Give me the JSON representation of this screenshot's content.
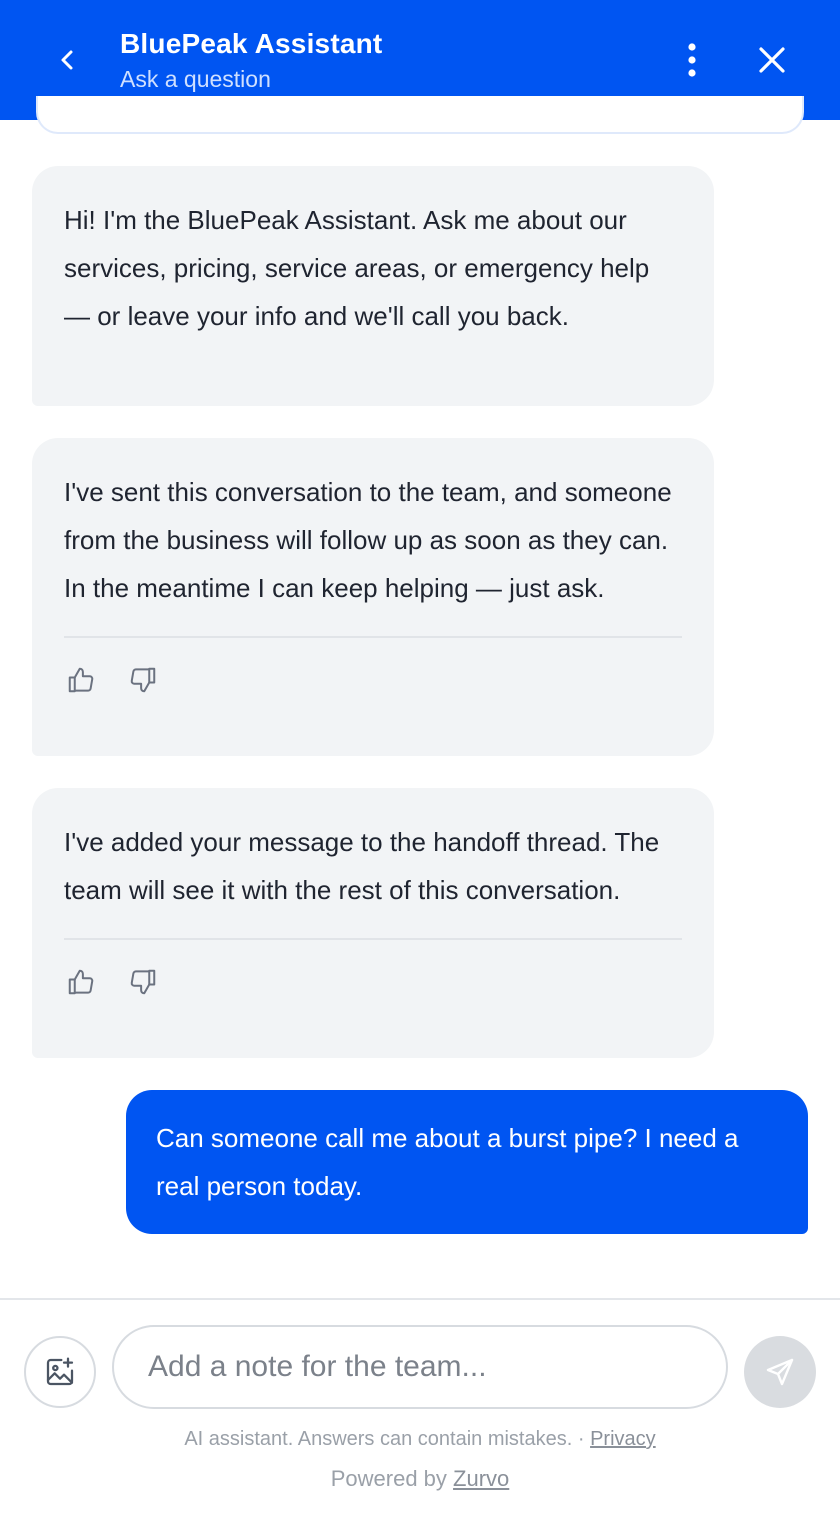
{
  "header": {
    "title": "BluePeak Assistant",
    "subtitle": "Ask a question",
    "back_icon": "chevron-left-icon",
    "more_icon": "more-vertical-icon",
    "close_icon": "close-icon",
    "background_color": "#0055f2"
  },
  "messages": [
    {
      "role": "assistant",
      "text": "Hi! I'm the BluePeak Assistant. Ask me about our services, pricing, service areas, or emergency help — or leave your info and we'll call you back."
    },
    {
      "role": "assistant",
      "text": "I've sent this conversation to the team, and someone from the business will follow up as soon as they can. In the meantime I can keep helping — just ask.",
      "feedback": [
        "thumbs-up-icon",
        "thumbs-down-icon"
      ]
    },
    {
      "role": "assistant",
      "text": "I've added your message to the handoff thread. The team will see it with the rest of this conversation.",
      "feedback": [
        "thumbs-up-icon",
        "thumbs-down-icon"
      ]
    },
    {
      "role": "user",
      "text": "Can someone call me about a burst pipe? I need a real person today."
    }
  ],
  "composer": {
    "placeholder": "Add a note for the team...",
    "value": "",
    "attach_icon": "image-add-icon",
    "send_icon": "send-icon"
  },
  "footer": {
    "disclaimer": "AI assistant. Answers can contain mistakes. ·",
    "privacy_link": "Privacy",
    "powered_prefix": "Powered by",
    "powered_link": "Zurvo"
  },
  "colors": {
    "accent": "#0055f2",
    "assistant_bubble": "#f2f4f6",
    "send_button_disabled": "#d9dce0"
  }
}
